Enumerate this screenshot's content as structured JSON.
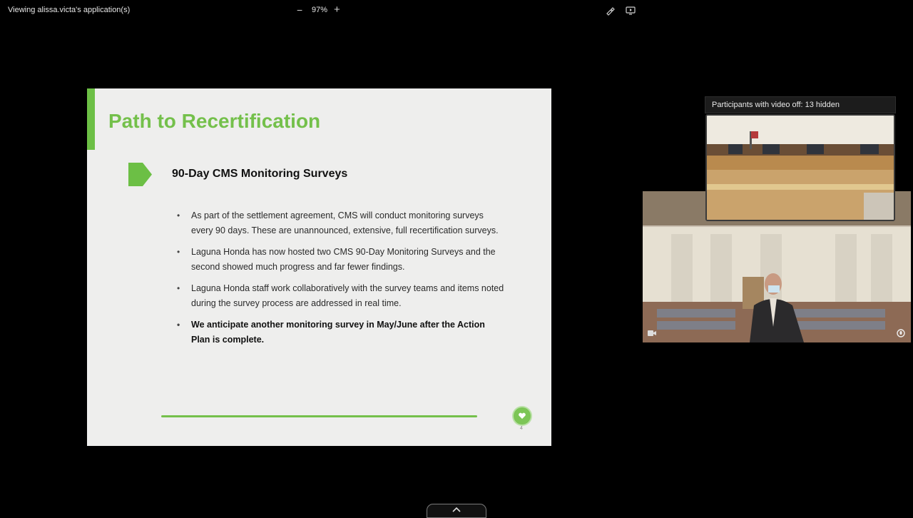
{
  "topbar": {
    "viewing_text": "Viewing alissa.victa's application(s)",
    "zoom_minus": "−",
    "zoom_level": "97%",
    "zoom_plus": "+",
    "annotate_icon": "annotate-icon",
    "remote_control_icon": "remote-control-icon"
  },
  "slide": {
    "title": "Path to Recertification",
    "section_heading": "90-Day CMS Monitoring Surveys",
    "bullets": [
      "As part of the settlement agreement, CMS will conduct monitoring surveys every 90 days. These are unannounced, extensive, full recertification surveys.",
      "Laguna Honda has now hosted two CMS 90-Day Monitoring Surveys and the second showed much progress and far fewer findings.",
      "Laguna Honda staff work collaboratively with the survey teams and items noted during the survey process are addressed in real time.",
      "We anticipate another monitoring survey in May/June after the Action Plan is complete."
    ],
    "bullet_symbol": "•",
    "page_number": "4",
    "accent_color": "#74c04b"
  },
  "participants": {
    "header_text": "Participants with video off: 13 hidden"
  }
}
